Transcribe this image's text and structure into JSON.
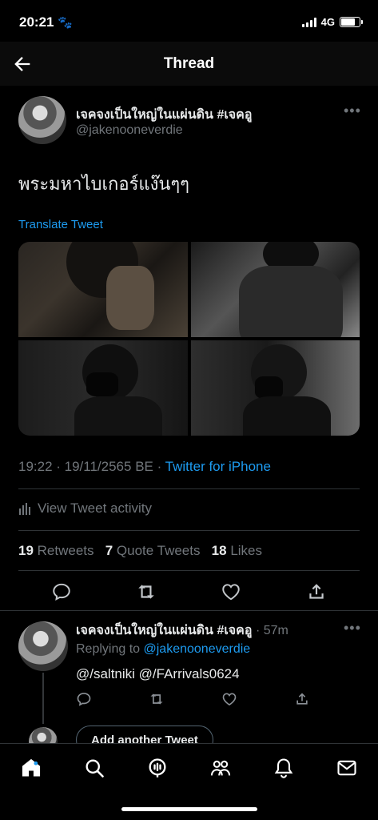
{
  "status_bar": {
    "time": "20:21",
    "network": "4G"
  },
  "header": {
    "title": "Thread"
  },
  "tweet": {
    "display_name": "เจคจงเป็นใหญ่ในแผ่นดิน #เจคอู",
    "handle": "@jakenooneverdie",
    "text": "พระมหาไบเกอร์แง๊นๆๆ",
    "translate_label": "Translate Tweet",
    "timestamp": "19:22 · 19/11/2565 BE · ",
    "client": "Twitter for iPhone",
    "activity_label": "View Tweet activity",
    "stats": {
      "retweets_count": "19",
      "retweets_label": "Retweets",
      "quotes_count": "7",
      "quotes_label": "Quote Tweets",
      "likes_count": "18",
      "likes_label": "Likes"
    }
  },
  "reply": {
    "display_name": "เจคจงเป็นใหญ่ในแผ่นดิน #เจคอู",
    "time": " · 57m",
    "replying_prefix": "Replying to ",
    "replying_to": "@jakenooneverdie",
    "text": "@/saltniki @/FArrivals0624"
  },
  "add_another_label": "Add another Tweet",
  "colors": {
    "accent": "#1d9bf0",
    "background": "#000000",
    "muted": "#71767b"
  },
  "tabs": [
    "home-icon",
    "search-icon",
    "spaces-icon",
    "communities-icon",
    "notifications-icon",
    "messages-icon"
  ]
}
